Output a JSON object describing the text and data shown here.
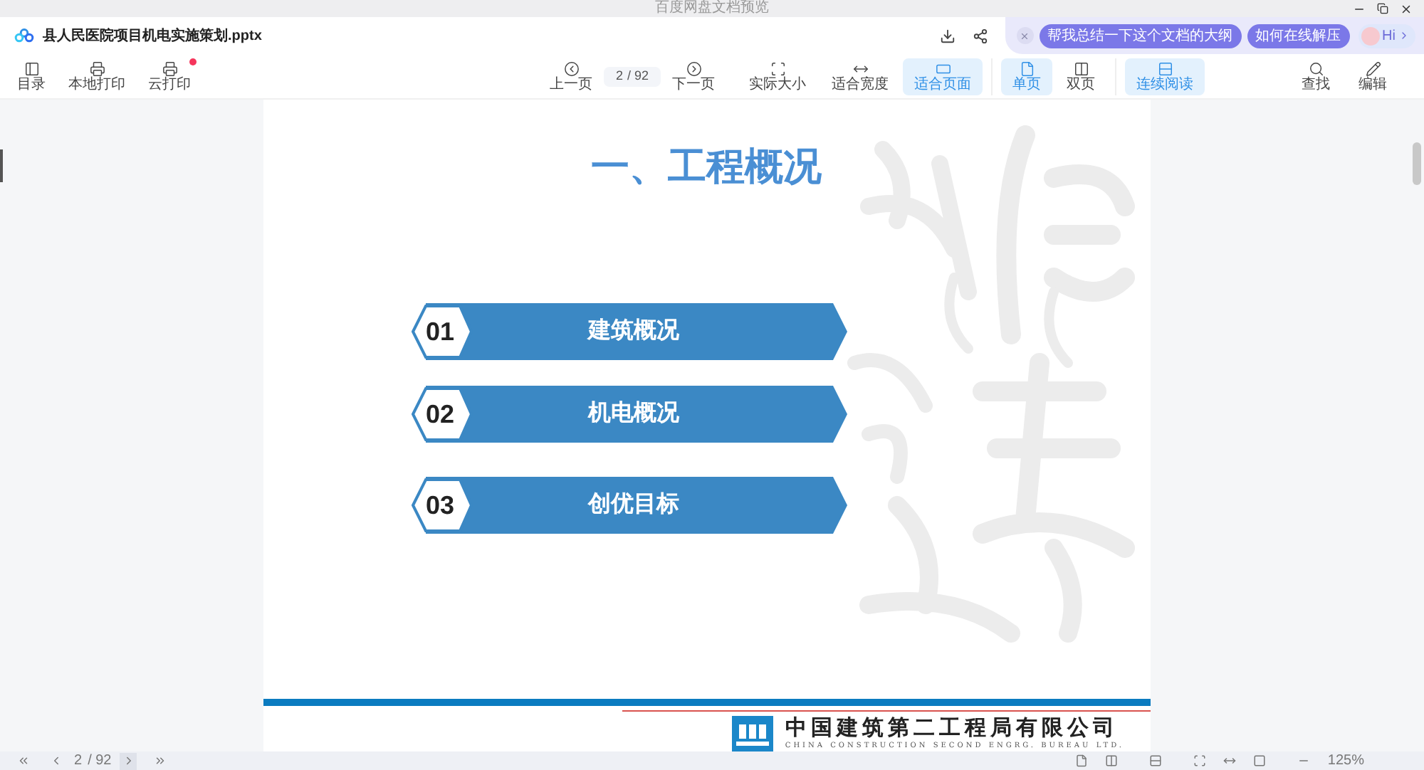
{
  "window": {
    "title": "百度网盘文档预览"
  },
  "header": {
    "file_name": "县人民医院项目机电实施策划.pptx",
    "ai_suggestions": [
      "帮我总结一下这个文档的大纲",
      "如何在线解压"
    ],
    "assistant_greeting": "Hi"
  },
  "toolbar": {
    "left": [
      {
        "label": "目录",
        "badge": false
      },
      {
        "label": "本地打印",
        "badge": false
      },
      {
        "label": "云打印",
        "badge": true
      }
    ],
    "page_nav": {
      "prev": "上一页",
      "page": "2",
      "total": "/ 92",
      "next": "下一页"
    },
    "view_groups": [
      [
        {
          "label": "实际大小",
          "selected": false
        },
        {
          "label": "适合宽度",
          "selected": false
        },
        {
          "label": "适合页面",
          "selected": true
        }
      ],
      [
        {
          "label": "单页",
          "selected": true
        },
        {
          "label": "双页",
          "selected": false
        }
      ],
      [
        {
          "label": "连续阅读",
          "selected": true
        }
      ]
    ],
    "right": [
      {
        "label": "查找"
      },
      {
        "label": "编辑"
      }
    ]
  },
  "slide": {
    "title": "一、工程概况",
    "items": [
      {
        "number": "01",
        "label": "建筑概况"
      },
      {
        "number": "02",
        "label": "机电概况"
      },
      {
        "number": "03",
        "label": "创优目标"
      }
    ],
    "company_cn": "中国建筑第二工程局有限公司",
    "company_en": "CHINA CONSTRUCTION SECOND ENGRG. BUREAU LTD."
  },
  "status_bar": {
    "page": "2",
    "total": "/ 92",
    "zoom": "125%"
  }
}
